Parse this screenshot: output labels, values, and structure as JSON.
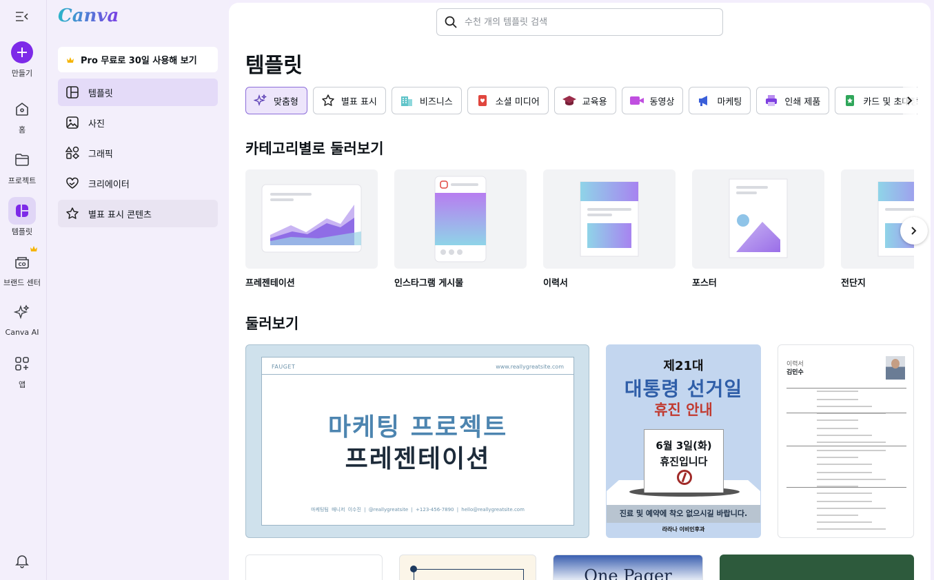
{
  "rail": {
    "create_label": "만들기",
    "items": [
      {
        "label": "홈",
        "icon": "home-icon"
      },
      {
        "label": "프로젝트",
        "icon": "folder-icon"
      },
      {
        "label": "템플릿",
        "icon": "templates-icon"
      },
      {
        "label": "브랜드 센터",
        "icon": "brand-icon"
      },
      {
        "label": "Canva AI",
        "icon": "sparkle-icon"
      },
      {
        "label": "앱",
        "icon": "apps-icon"
      }
    ]
  },
  "panel": {
    "logo": "Canva",
    "pro_button": "Pro 무료로 30일 사용해 보기",
    "nav": [
      {
        "label": "템플릿"
      },
      {
        "label": "사진"
      },
      {
        "label": "그래픽"
      },
      {
        "label": "크리에이터"
      },
      {
        "label": "별표 표시 콘텐츠"
      }
    ]
  },
  "main": {
    "search_placeholder": "수천 개의 템플릿 검색",
    "title": "템플릿",
    "chips": [
      {
        "label": "맞춤형",
        "icon": "sparkle-icon"
      },
      {
        "label": "별표 표시",
        "icon": "star-icon"
      },
      {
        "label": "비즈니스",
        "icon": "building-icon"
      },
      {
        "label": "소셜 미디어",
        "icon": "heart-card-icon"
      },
      {
        "label": "교육용",
        "icon": "graduation-cap-icon"
      },
      {
        "label": "동영상",
        "icon": "video-camera-icon"
      },
      {
        "label": "마케팅",
        "icon": "megaphone-icon"
      },
      {
        "label": "인쇄 제품",
        "icon": "printer-icon"
      },
      {
        "label": "카드 및 초대장",
        "icon": "card-icon"
      }
    ],
    "categories_title": "카테고리별로 둘러보기",
    "categories": [
      {
        "label": "프레젠테이션"
      },
      {
        "label": "인스타그램 게시물"
      },
      {
        "label": "이력서"
      },
      {
        "label": "포스터"
      },
      {
        "label": "전단지"
      }
    ],
    "browse_title": "둘러보기",
    "presentation": {
      "brand": "FAUGET",
      "url": "www.reallygreatsite.com",
      "title1": "마케팅 프로젝트",
      "title2": "프레젠테이션",
      "footer": "마케팅팀 매니저 이수진 | @reallygreatsite | +123-456-7890 | hello@reallygreatsite.com"
    },
    "poster": {
      "line1": "제21대",
      "line2": "대통령 선거일",
      "line3": "휴진 안내",
      "date": "6월 3일(화)",
      "closed": "휴진입니다",
      "notice": "진료 및 예약에 착오 없으시길 바랍니다.",
      "clinic": "라라나 이비인후과"
    },
    "resume": {
      "title": "이력서",
      "name": "김민수"
    },
    "one_pager": "One Pager"
  },
  "colors": {
    "accent": "#7d2ae8",
    "active_bg": "#e4dbf8"
  }
}
